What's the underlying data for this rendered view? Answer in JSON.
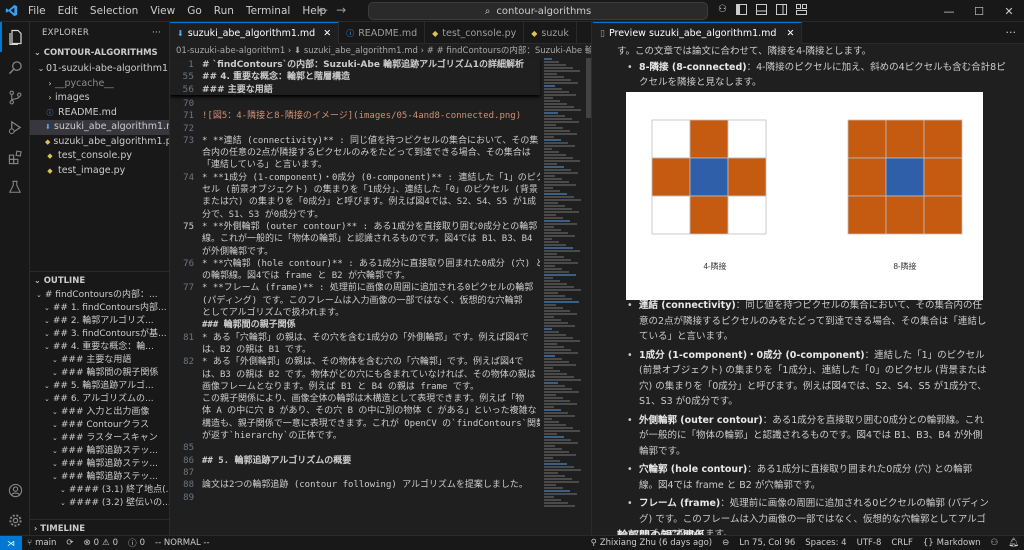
{
  "titlebar": {
    "menu": [
      "File",
      "Edit",
      "Selection",
      "View",
      "Go",
      "Run",
      "Terminal",
      "Help"
    ],
    "search_text": "contour-algorithms"
  },
  "sidebar": {
    "explorer_title": "EXPLORER",
    "project": "CONTOUR-ALGORITHMS",
    "files": [
      {
        "label": "01-suzuki-abe-algorithm1",
        "kind": "folder-open",
        "indent": 0
      },
      {
        "label": "__pycache__",
        "kind": "folder",
        "indent": 1,
        "dim": true
      },
      {
        "label": "images",
        "kind": "folder",
        "indent": 1
      },
      {
        "label": "README.md",
        "kind": "info",
        "indent": 1
      },
      {
        "label": "suzuki_abe_algorithm1.md",
        "kind": "md",
        "indent": 1,
        "selected": true
      },
      {
        "label": "suzuki_abe_algorithm1.py",
        "kind": "py",
        "indent": 1
      },
      {
        "label": "test_console.py",
        "kind": "py",
        "indent": 1
      },
      {
        "label": "test_image.py",
        "kind": "py",
        "indent": 1
      }
    ],
    "outline_title": "OUTLINE",
    "outline": [
      {
        "label": "# findContoursの内部：...",
        "level": 0
      },
      {
        "label": "## 1. findContours内部...",
        "level": 1
      },
      {
        "label": "## 2. 輪郭アルゴリズ...",
        "level": 1
      },
      {
        "label": "## 3. findContoursが基...",
        "level": 1
      },
      {
        "label": "## 4. 重要な概念：輪...",
        "level": 1
      },
      {
        "label": "### 主要な用語",
        "level": 2
      },
      {
        "label": "### 輪郭間の親子関係",
        "level": 2
      },
      {
        "label": "## 5. 輪郭追跡アルゴ...",
        "level": 1
      },
      {
        "label": "## 6. アルゴリズムの...",
        "level": 1
      },
      {
        "label": "### 入力と出力画像",
        "level": 2
      },
      {
        "label": "### Contourクラス",
        "level": 2
      },
      {
        "label": "### ラスタースキャン",
        "level": 2
      },
      {
        "label": "### 輪郭追跡ステッ...",
        "level": 2
      },
      {
        "label": "### 輪郭追跡ステッ...",
        "level": 2
      },
      {
        "label": "### 輪郭追跡ステッ...",
        "level": 2
      },
      {
        "label": "#### (3.1) 終了地点(...",
        "level": 3
      },
      {
        "label": "#### (3.2) 壁伝いの...",
        "level": 3
      }
    ],
    "timeline_title": "TIMELINE"
  },
  "editor": {
    "tabs": [
      {
        "label": "suzuki_abe_algorithm1.md",
        "kind": "md",
        "active": true
      },
      {
        "label": "README.md",
        "kind": "info"
      },
      {
        "label": "test_console.py",
        "kind": "py"
      },
      {
        "label": "suzuk",
        "kind": "py"
      }
    ],
    "breadcrumb": "01-suzuki-abe-algorithm1 › ⬇ suzuki_abe_algorithm1.md › # # findContoursの内部：Suzuki-Abe 輪郭追跡アル",
    "sticky": [
      {
        "ln": "1",
        "text": "# `findContours`の内部：Suzuki-Abe 輪郭追跡アルゴリズム1の詳細解析"
      },
      {
        "ln": "55",
        "text": "## 4. 重要な概念：輪郭と階層構造"
      },
      {
        "ln": "56",
        "text": "### 主要な用語"
      }
    ],
    "lines": [
      {
        "ln": "",
        "text": ""
      },
      {
        "ln": "70",
        "text": ""
      },
      {
        "ln": "71",
        "text": "![図5：4-隣接と8-隣接のイメージ](images/05-4and8-connected.png)"
      },
      {
        "ln": "72",
        "text": ""
      },
      {
        "ln": "73",
        "text": "* **連結 (connectivity)** : 同じ値を持つピクセルの集合において、その集"
      },
      {
        "ln": "",
        "text": "合内の任意の2点が隣接するピクセルのみをたどって到達できる場合、その集合は"
      },
      {
        "ln": "",
        "text": "「連結している」と言います。"
      },
      {
        "ln": "74",
        "text": "* **1成分 (1-component)・0成分 (0-component)** : 連結した「1」のピク"
      },
      {
        "ln": "",
        "text": "セル (前景オブジェクト) の集まりを「1成分」、連結した「0」のピクセル (背景"
      },
      {
        "ln": "",
        "text": "または穴) の集まりを「0成分」と呼びます。例えば図4では、S2、S4、S5 が1成"
      },
      {
        "ln": "",
        "text": "分で、S1、S3 が0成分です。"
      },
      {
        "ln": "75",
        "text": "* **外側輪郭 (outer contour)** : ある1成分を直接取り囲む0成分との輪郭"
      },
      {
        "ln": "",
        "text": "線。これが一般的に「物体の輪郭」と認識されるものです。図4では B1、B3、B4"
      },
      {
        "ln": "",
        "text": "が外側輪郭です。"
      },
      {
        "ln": "76",
        "text": "* **穴輪郭 (hole contour)** : ある1成分に直接取り囲まれた0成分 (穴) と"
      },
      {
        "ln": "",
        "text": "の輪郭線。図4では frame と B2 が穴輪郭です。"
      },
      {
        "ln": "77",
        "text": "* **フレーム (frame)** : 処理前に画像の周囲に追加される0ピクセルの輪郭"
      },
      {
        "ln": "",
        "text": "(パディング) です。このフレームは入力画像の一部ではなく、仮想的な穴輪郭"
      },
      {
        "ln": "",
        "text": "としてアルゴリズムで扱われます。"
      },
      {
        "ln": "",
        "text": ""
      },
      {
        "ln": "",
        "text": "### 輪郭間の親子関係"
      },
      {
        "ln": "",
        "text": ""
      },
      {
        "ln": "81",
        "text": "* ある「穴輪郭」の親は、その穴を含む1成分の「外側輪郭」です。例えば図4で"
      },
      {
        "ln": "",
        "text": "は、B2 の親は B1 です。"
      },
      {
        "ln": "82",
        "text": "* ある「外側輪郭」の親は、その物体を含む穴の「穴輪郭」です。例えば図4で"
      },
      {
        "ln": "",
        "text": "は、B3 の親は B2 です。物体がどの穴にも含まれていなければ、その物体の親は"
      },
      {
        "ln": "",
        "text": "画像フレームとなります。例えば B1 と B4 の親は frame です。"
      },
      {
        "ln": "",
        "text": ""
      },
      {
        "ln": "",
        "text": "この親子関係により、画像全体の輪郭は木構造として表現できます。例えば「物"
      },
      {
        "ln": "",
        "text": "体 A の中に穴 B があり、その穴 B の中に別の物体 C がある」といった複雑な"
      },
      {
        "ln": "",
        "text": "構造も、親子関係で一意に表現できます。これが OpenCV の`findContours`関数"
      },
      {
        "ln": "",
        "text": "が返す`hierarchy`の正体です。"
      },
      {
        "ln": "85",
        "text": ""
      },
      {
        "ln": "86",
        "text": "## 5. 輪郭追跡アルゴリズムの概要"
      },
      {
        "ln": "87",
        "text": ""
      },
      {
        "ln": "88",
        "text": "論文は2つの輪郭追跡 (contour following) アルゴリズムを提案しました。"
      },
      {
        "ln": "89",
        "text": ""
      }
    ]
  },
  "preview": {
    "tab_label": "Preview suzuki_abe_algorithm1.md",
    "top_line": "す。この文章では論文に合わせて、隣接を4-隣接とします。",
    "eight_term": "8-隣接 (8-connected)",
    "eight_text": "：4-隣接のピクセルに加え、斜めの4ピクセルも含む合計8ピクセルを隣接と見なします。",
    "img_label_4": "4-隣接",
    "img_label_8": "8-隣接",
    "items": [
      {
        "term": "連結 (connectivity)",
        "text": "：同じ値を持つピクセルの集合において、その集合内の任意の2点が隣接するピクセルのみをたどって到達できる場合、その集合は「連結している」と言います。"
      },
      {
        "term": "1成分 (1-component)・0成分 (0-component)",
        "text": "：連結した「1」のピクセル (前景オブジェクト) の集まりを「1成分」、連結した「0」のピクセル (背景または穴) の集まりを「0成分」と呼びます。例えば図4では、S2、S4、S5 が1成分で、S1、S3 が0成分です。"
      },
      {
        "term": "外側輪郭 (outer contour)",
        "text": "：ある1成分を直接取り囲む0成分との輪郭線。これが一般的に「物体の輪郭」と認識されるものです。図4では B1、B3、B4 が外側輪郭です。"
      },
      {
        "term": "穴輪郭 (hole contour)",
        "text": "：ある1成分に直接取り囲まれた0成分 (穴) との輪郭線。図4では frame と B2 が穴輪郭です。"
      },
      {
        "term": "フレーム (frame)",
        "text": "：処理前に画像の周囲に追加される0ピクセルの輪郭 (パディング) です。このフレームは入力画像の一部ではなく、仮想的な穴輪郭としてアルゴリズムで扱われます。"
      }
    ],
    "cut_heading": "輪郭間の親子関係"
  },
  "statusbar": {
    "branch": "main",
    "errors": "0",
    "warnings": "0",
    "info": "0",
    "mode": "-- NORMAL --",
    "blame": "Zhixiang Zhu (6 days ago)",
    "position": "Ln 75, Col 96",
    "spaces": "Spaces: 4",
    "encoding": "UTF-8",
    "eol": "CRLF",
    "language": "Markdown"
  },
  "colors": {
    "accent": "#0078d4",
    "orange_cell": "#c55a11",
    "blue_cell": "#2e5fa8"
  }
}
